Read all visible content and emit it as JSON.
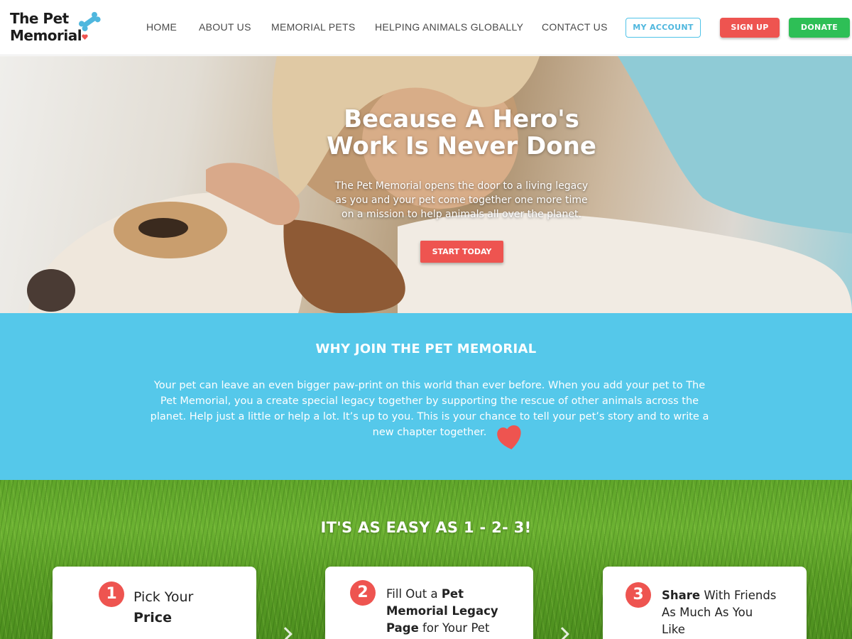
{
  "logo": {
    "line1": "The Pet",
    "line2": "Memorial"
  },
  "nav": [
    {
      "label": "HOME"
    },
    {
      "label": "ABOUT US"
    },
    {
      "label": "MEMORIAL PETS"
    },
    {
      "label": "HELPING ANIMALS GLOBALLY"
    },
    {
      "label": "CONTACT US"
    }
  ],
  "buttons": {
    "account": "MY ACCOUNT",
    "signup": "SIGN UP",
    "donate": "DONATE"
  },
  "hero": {
    "title_line1": "Because A Hero's",
    "title_line2": "Work Is Never Done",
    "sub_line1": "The Pet Memorial opens the door to a living legacy",
    "sub_line2": "as you and your pet come together one more time",
    "sub_line3": "on a mission to help animals all over the planet.",
    "cta": "START TODAY"
  },
  "why": {
    "title": "WHY JOIN THE PET MEMORIAL",
    "line1": "Your pet can leave an even bigger paw-print on this world than ever before. When you add your pet to The",
    "line2": "Pet Memorial, you a create special legacy together by supporting the rescue of other animals across the",
    "line3": "planet. Help just a little or help a lot. It’s up to you. This is your chance to tell your pet’s story and to write a",
    "line4": "new chapter together."
  },
  "steps": {
    "title": "IT'S AS EASY AS 1 - 2- 3!",
    "items": [
      {
        "number": "1",
        "parts": [
          "Pick Your",
          "Price"
        ]
      },
      {
        "number": "2",
        "parts": [
          "Fill Out a",
          "Pet",
          "Memorial Legacy",
          "Page",
          "for Your Pet"
        ]
      },
      {
        "number": "3",
        "parts": [
          "Share",
          "With Friends",
          "As Much As You",
          "Like"
        ]
      }
    ]
  },
  "colors": {
    "accent_red": "#ee5450",
    "accent_blue": "#55c8ea",
    "accent_green": "#2ebf56"
  },
  "icons": {
    "logo_bone": "bone-icon",
    "logo_heart": "heart-icon",
    "why_heart": "heart-icon"
  }
}
